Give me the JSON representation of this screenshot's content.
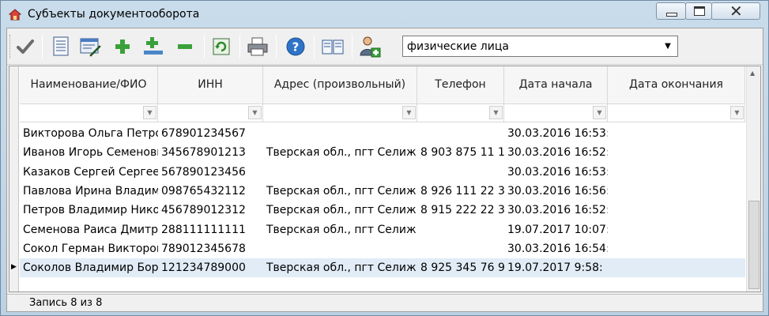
{
  "window": {
    "title": "Субъекты документооборота",
    "icons": {
      "app": "house-icon",
      "minimize": "minimize-icon",
      "maximize": "maximize-icon",
      "close": "close-icon"
    }
  },
  "toolbar": {
    "buttons": [
      {
        "name": "apply-button",
        "icon": "checkmark-icon"
      },
      {
        "name": "view-document-button",
        "icon": "document-icon"
      },
      {
        "name": "edit-document-button",
        "icon": "edit-form-icon"
      },
      {
        "name": "add-button",
        "icon": "plus-icon"
      },
      {
        "name": "add-record-button",
        "icon": "plus-line-icon"
      },
      {
        "name": "remove-button",
        "icon": "minus-icon"
      },
      {
        "name": "refresh-button",
        "icon": "refresh-icon"
      },
      {
        "name": "print-button",
        "icon": "printer-icon"
      },
      {
        "name": "help-button",
        "icon": "help-icon"
      },
      {
        "name": "catalog-button",
        "icon": "book-icon"
      },
      {
        "name": "users-button",
        "icon": "user-icon"
      }
    ],
    "filter_select": {
      "value": "физические лица"
    }
  },
  "grid": {
    "columns": [
      "Наименование/ФИО",
      "ИНН",
      "Адрес (произвольный)",
      "Телефон",
      "Дата начала",
      "Дата окончания"
    ],
    "rows": [
      [
        "Викторова Ольга Петровна",
        "678901234567",
        "",
        "",
        "30.03.2016 16:53:",
        ""
      ],
      [
        "Иванов Игорь Семенович",
        "345678901213",
        "Тверская обл., пгт Селиж",
        "8 903 875 11 1",
        "30.03.2016 16:52:",
        ""
      ],
      [
        "Казаков Сергей Сергеевич",
        "567890123456",
        "",
        "",
        "30.03.2016 16:53:",
        ""
      ],
      [
        "Павлова Ирина Владим",
        "098765432112",
        "Тверская обл., пгт Селиж",
        "8 926 111 22 3",
        "30.03.2016 16:56:",
        ""
      ],
      [
        "Петров Владимир Нико",
        "456789012312",
        "Тверская обл., пгт Селиж",
        "8 915 222 22 3",
        "30.03.2016 16:52:",
        ""
      ],
      [
        "Семенова Раиса Дмитри",
        "288111111111",
        "Тверская обл., пгт Селиж",
        "",
        "19.07.2017 10:07:",
        ""
      ],
      [
        "Сокол Герман Викторов",
        "789012345678",
        "",
        "",
        "30.03.2016 16:54:",
        ""
      ],
      [
        "Соколов Владимир Бор",
        "121234789000",
        "Тверская обл., пгт Селиж",
        "8 925 345 76 9",
        "19.07.2017 9:58:",
        ""
      ]
    ],
    "selected_row": 7
  },
  "status": {
    "text": "Запись 8 из 8"
  }
}
